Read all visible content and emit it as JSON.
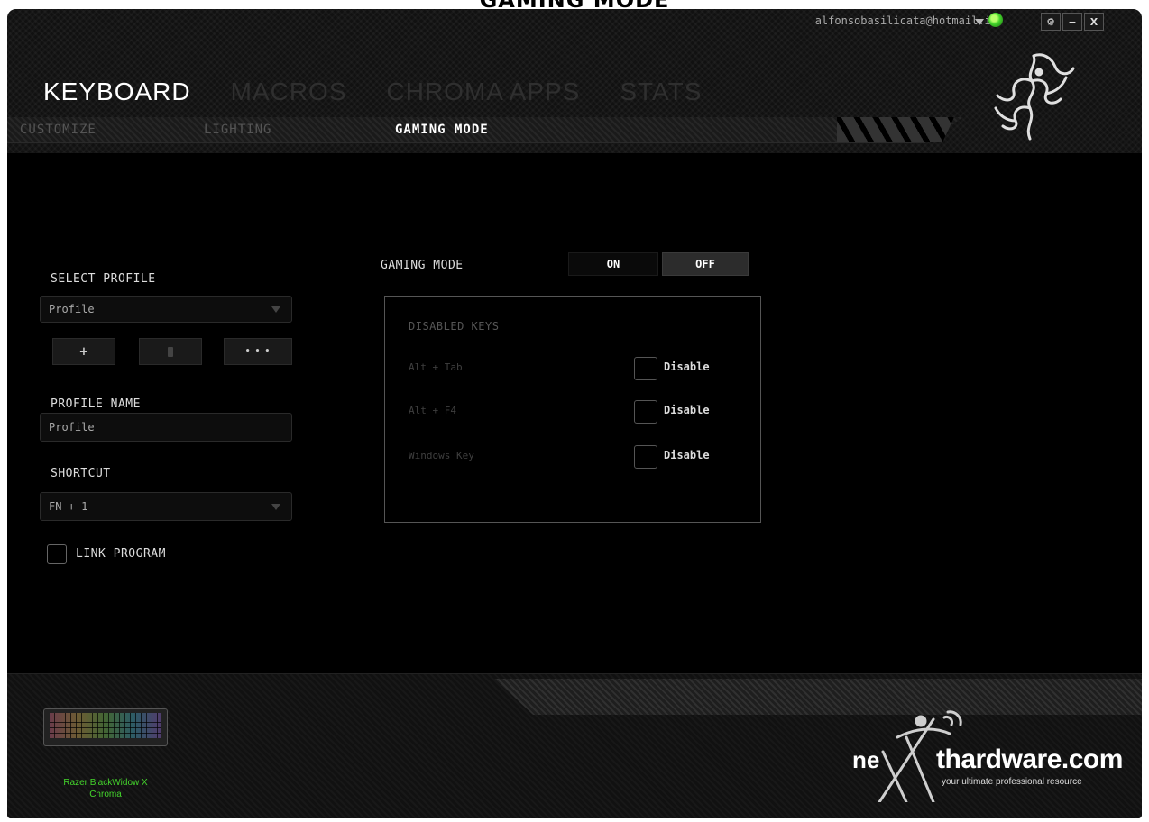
{
  "caption": "GAMING MODE",
  "header": {
    "account_email": "alfonsobasilicata@hotmail.it",
    "window_controls": {
      "settings": "⚙",
      "minimize": "−",
      "close": "X"
    },
    "tabs": [
      {
        "label": "KEYBOARD",
        "active": true
      },
      {
        "label": "MACROS",
        "active": false
      },
      {
        "label": "CHROMA APPS",
        "active": false
      },
      {
        "label": "STATS",
        "active": false
      }
    ],
    "subtabs": [
      {
        "label": "CUSTOMIZE",
        "active": false
      },
      {
        "label": "LIGHTING",
        "active": false
      },
      {
        "label": "GAMING MODE",
        "active": true
      }
    ]
  },
  "profile": {
    "select_label": "SELECT PROFILE",
    "selected": "Profile",
    "add_icon": "+",
    "more_icon": "• • •",
    "name_label": "PROFILE NAME",
    "name_value": "Profile",
    "shortcut_label": "SHORTCUT",
    "shortcut_value": "FN + 1",
    "link_program_label": "LINK PROGRAM"
  },
  "gaming_mode": {
    "label": "GAMING MODE",
    "on_label": "ON",
    "off_label": "OFF",
    "state": "off",
    "disabled_keys_title": "DISABLED KEYS",
    "keys": [
      {
        "name": "Alt + Tab",
        "option": "Disable"
      },
      {
        "name": "Alt + F4",
        "option": "Disable"
      },
      {
        "name": "Windows Key",
        "option": "Disable"
      }
    ]
  },
  "device": {
    "name_line1": "Razer BlackWidow X",
    "name_line2": "Chroma"
  },
  "watermark": {
    "ne": "ne",
    "brand": "thardware",
    "domain": ".com",
    "tagline": "your ultimate professional resource"
  },
  "colors": {
    "accent_green": "#44d62c",
    "background": "#000000"
  }
}
